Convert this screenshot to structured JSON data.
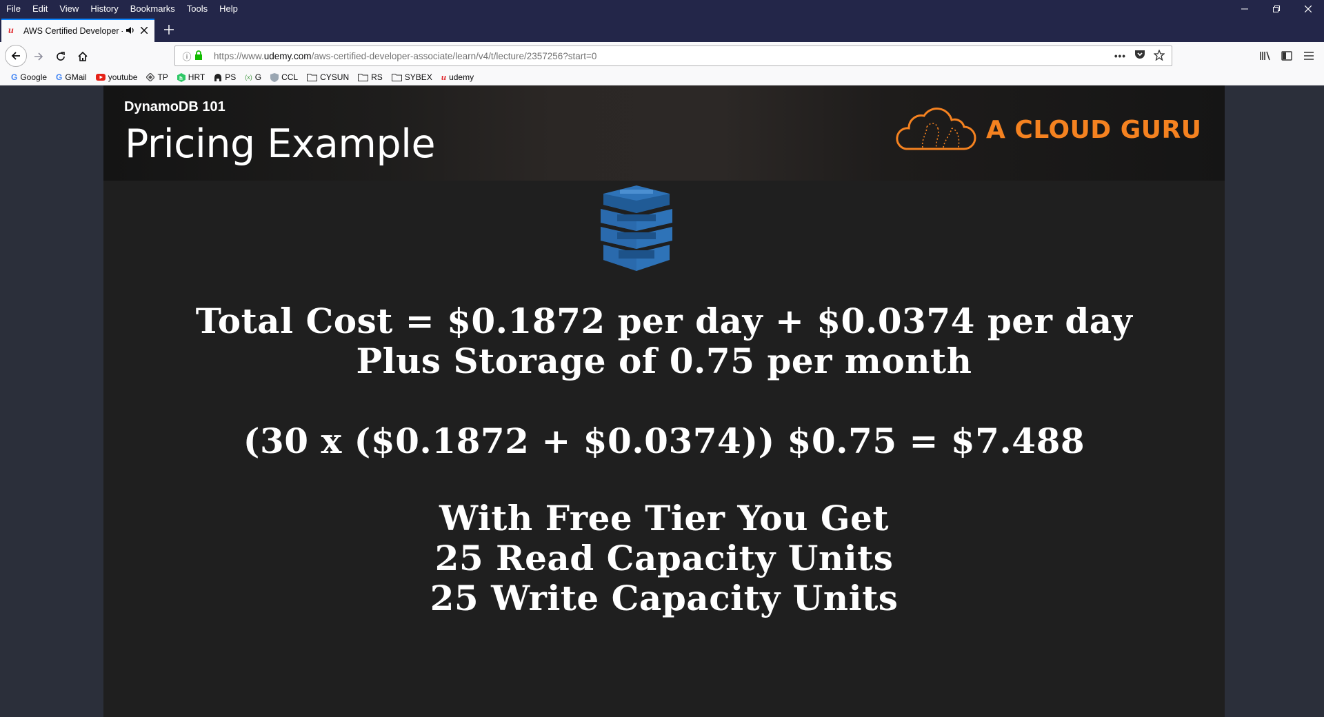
{
  "menubar": {
    "items": [
      "File",
      "Edit",
      "View",
      "History",
      "Bookmarks",
      "Tools",
      "Help"
    ]
  },
  "tab": {
    "title": "AWS Certified Developer - A",
    "favicon": "udemy-icon"
  },
  "urlbar": {
    "url_prefix": "https://www.",
    "url_domain": "udemy.com",
    "url_path": "/aws-certified-developer-associate/learn/v4/t/lecture/2357256?start=0"
  },
  "bookmarks": [
    {
      "label": "Google",
      "icon": "google-icon"
    },
    {
      "label": "GMail",
      "icon": "google-icon"
    },
    {
      "label": "youtube",
      "icon": "youtube-icon"
    },
    {
      "label": "TP",
      "icon": "tp-icon"
    },
    {
      "label": "HRT",
      "icon": "hackerrank-icon"
    },
    {
      "label": "PS",
      "icon": "ps-icon"
    },
    {
      "label": "G",
      "icon": "g-icon"
    },
    {
      "label": "CCL",
      "icon": "ccl-icon"
    },
    {
      "label": "CYSUN",
      "icon": "folder-icon"
    },
    {
      "label": "RS",
      "icon": "folder-icon"
    },
    {
      "label": "SYBEX",
      "icon": "folder-icon"
    },
    {
      "label": "udemy",
      "icon": "udemy-icon"
    }
  ],
  "slide": {
    "subtitle": "DynamoDB 101",
    "title": "Pricing Example",
    "brand": "A CLOUD GURU",
    "lines": [
      "Total Cost = $0.1872 per day + $0.0374  per day",
      "Plus Storage of 0.75 per month",
      "(30 x ($0.1872 + $0.0374)) $0.75 = $7.488",
      "With Free Tier You Get",
      "25 Read Capacity Units",
      "25 Write Capacity Units"
    ]
  },
  "colors": {
    "titlebar": "#232649",
    "brand": "#f58220",
    "slide_bg": "#1f1f1f",
    "dynamo_blue": "#2e73b8"
  }
}
